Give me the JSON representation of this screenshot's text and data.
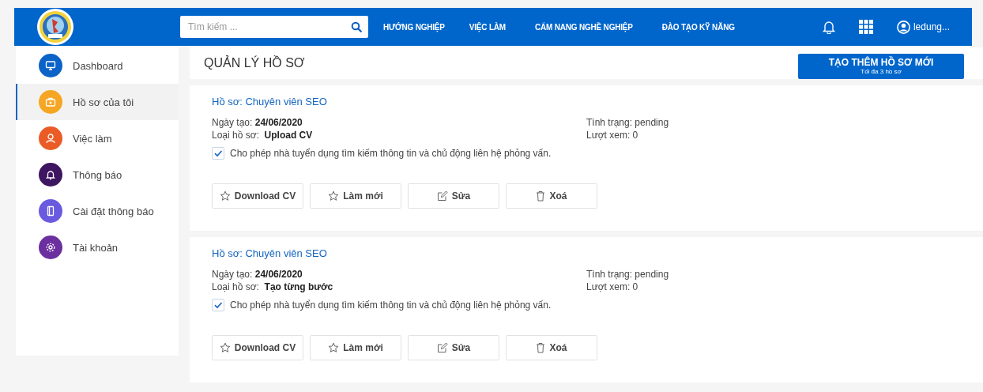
{
  "header": {
    "search": {
      "placeholder": "Tìm kiếm ..."
    },
    "nav": [
      {
        "label": "HƯỚNG NGHIỆP"
      },
      {
        "label": "VIỆC LÀM"
      },
      {
        "label": "CẨM NANG NGHỀ NGHIỆP"
      },
      {
        "label": "ĐÀO TẠO KỸ NĂNG"
      }
    ],
    "user": "ledung..."
  },
  "sidebar": {
    "items": [
      {
        "label": "Dashboard",
        "kind": "monitor",
        "color": "#0b63c7",
        "selected": false
      },
      {
        "label": "Hồ sơ của tôi",
        "kind": "briefcase",
        "color": "#f5a623",
        "selected": true
      },
      {
        "label": "Việc làm",
        "kind": "user",
        "color": "#eb5b25",
        "selected": false
      },
      {
        "label": "Thông báo",
        "kind": "bell",
        "color": "#3d1560",
        "selected": false
      },
      {
        "label": "Cài đặt thông báo",
        "kind": "notebook",
        "color": "#6a5ae0",
        "selected": false
      },
      {
        "label": "Tài khoản",
        "kind": "gear",
        "color": "#6b2fa0",
        "selected": false
      }
    ]
  },
  "page": {
    "title": "QUẢN LÝ HỒ SƠ",
    "create_button": {
      "label": "TẠO THÊM HỒ SƠ MỚI",
      "note": "Tối đa 3 hồ sơ"
    }
  },
  "profiles": [
    {
      "title": "Hồ sơ: Chuyên viên SEO",
      "created_label": "Ngày tạo:",
      "created": "24/06/2020",
      "type_label": "Loại hồ sơ:",
      "type": "Upload CV",
      "status": "Tình trạng: pending",
      "views": "Lượt xem: 0",
      "consent": {
        "label": "Cho phép nhà tuyển dụng tìm kiếm thông tin và chủ động liên hệ phỏng vấn.",
        "checked": true
      },
      "actions": [
        {
          "label": "Download CV",
          "kind": "star"
        },
        {
          "label": "Làm mới",
          "kind": "star"
        },
        {
          "label": "Sửa",
          "kind": "edit"
        },
        {
          "label": "Xoá",
          "kind": "trash"
        }
      ]
    },
    {
      "title": "Hồ sơ: Chuyên viên SEO",
      "created_label": "Ngày tạo:",
      "created": "24/06/2020",
      "type_label": "Loại hồ sơ:",
      "type": "Tạo từng bước",
      "status": "Tình trạng: pending",
      "views": "Lượt xem: 0",
      "consent": {
        "label": "Cho phép nhà tuyển dụng tìm kiếm thông tin và chủ động liên hệ phỏng vấn.",
        "checked": true
      },
      "actions": [
        {
          "label": "Download CV",
          "kind": "star"
        },
        {
          "label": "Làm mới",
          "kind": "star"
        },
        {
          "label": "Sửa",
          "kind": "edit"
        },
        {
          "label": "Xoá",
          "kind": "trash"
        }
      ]
    }
  ]
}
